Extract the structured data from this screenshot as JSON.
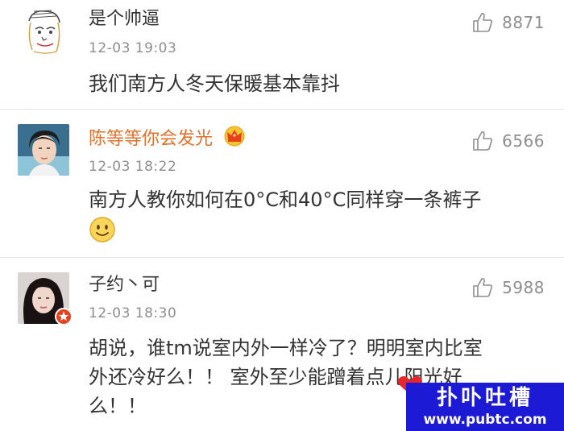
{
  "comments": [
    {
      "username": "是个帅逼",
      "time": "12-03 19:03",
      "likes": "8871",
      "content": "我们南方人冬天保暖基本靠抖"
    },
    {
      "username": "陈等等你会发光",
      "username_color": "#e0722d",
      "time": "12-03 18:22",
      "likes": "6566",
      "content": "南方人教你如何在0°C和40°C同样穿一条裤子",
      "badge_icon": "crown-badge-icon",
      "emoji": "smiley-emoji"
    },
    {
      "username": "子约丶可",
      "time": "12-03 18:30",
      "likes": "5988",
      "content_line1": "胡说，谁tm说室内外一样冷了？明明室内比室",
      "content_line2": "外还冷好么！！ 室外至少能蹭着点儿阳光好",
      "content_line3": "么！！",
      "verified_icon": "star-verified-icon"
    }
  ],
  "watermark": {
    "title": "扑卟吐槽",
    "url": "www.pubtc.com",
    "color": "#1d1ad6"
  }
}
